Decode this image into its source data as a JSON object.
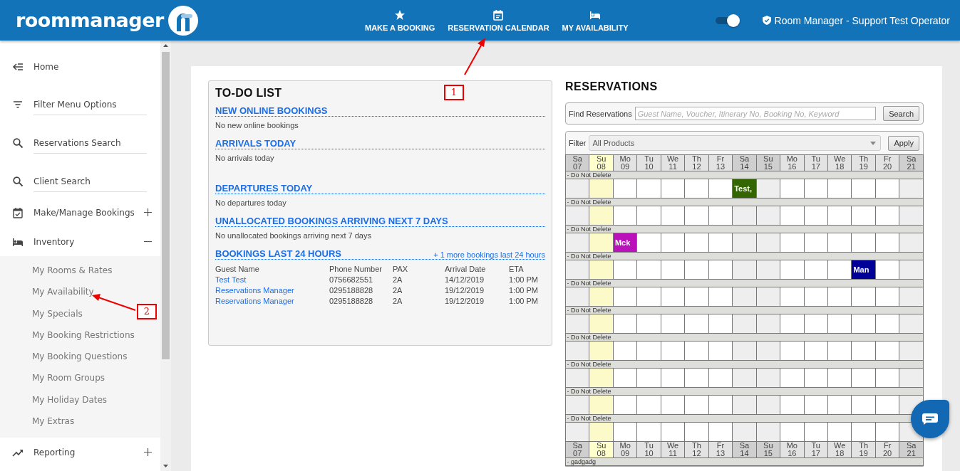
{
  "header": {
    "logo": "roommanager",
    "nav": [
      {
        "label": "MAKE A BOOKING"
      },
      {
        "label": "RESERVATION CALENDAR"
      },
      {
        "label": "MY AVAILABILITY"
      }
    ],
    "toggle": {
      "on": true
    },
    "user": "Room Manager - Support Test Operator"
  },
  "sidebar": {
    "items": [
      {
        "label": "Home",
        "kind": "link"
      },
      {
        "label": "Filter Menu Options",
        "kind": "field"
      },
      {
        "label": "Reservations Search",
        "kind": "field"
      },
      {
        "label": "Client Search",
        "kind": "field"
      },
      {
        "label": "Make/Manage Bookings",
        "kind": "group",
        "expanded": false
      },
      {
        "label": "Inventory",
        "kind": "group",
        "expanded": true,
        "children": [
          {
            "label": "My Rooms & Rates"
          },
          {
            "label": "My Availability"
          },
          {
            "label": "My Specials"
          },
          {
            "label": "My Booking Restrictions"
          },
          {
            "label": "My Booking Questions"
          },
          {
            "label": "My Room Groups"
          },
          {
            "label": "My Holiday Dates"
          },
          {
            "label": "My Extras"
          }
        ]
      },
      {
        "label": "Reporting",
        "kind": "group",
        "expanded": false
      }
    ]
  },
  "todo": {
    "title": "TO-DO LIST",
    "sections": [
      {
        "heading": "NEW ONLINE BOOKINGS",
        "message": "No new online bookings"
      },
      {
        "heading": "ARRIVALS TODAY",
        "message": "No arrivals today"
      },
      {
        "heading": "DEPARTURES TODAY",
        "message": "No departures today"
      },
      {
        "heading": "UNALLOCATED BOOKINGS ARRIVING NEXT 7 DAYS",
        "message": "No unallocated bookings arriving next 7 days"
      },
      {
        "heading": "BOOKINGS LAST 24 HOURS",
        "more_link": "+ 1 more bookings last 24 hours",
        "columns": [
          "Guest Name",
          "Phone Number",
          "PAX",
          "Arrival Date",
          "ETA"
        ],
        "rows": [
          [
            "Test Test",
            "0756682551",
            "2A",
            "14/12/2019",
            "1:00 PM"
          ],
          [
            "Reservations Manager",
            "0295188828",
            "2A",
            "19/12/2019",
            "1:00 PM"
          ],
          [
            "Reservations Manager",
            "0295188828",
            "2A",
            "19/12/2019",
            "1:00 PM"
          ]
        ]
      }
    ]
  },
  "reservations": {
    "title": "RESERVATIONS",
    "find_label": "Find Reservations",
    "find_placeholder": "Guest Name, Voucher, Itinerary No, Booking No, Keyword",
    "search_button": "Search",
    "filter_label": "Filter",
    "filter_value": "All Products",
    "apply_button": "Apply",
    "calendar": {
      "days": [
        {
          "dow": "Sa",
          "date": "07",
          "kind": "weekend"
        },
        {
          "dow": "Su",
          "date": "08",
          "kind": "today"
        },
        {
          "dow": "Mo",
          "date": "09",
          "kind": "weekday"
        },
        {
          "dow": "Tu",
          "date": "10",
          "kind": "weekday"
        },
        {
          "dow": "We",
          "date": "11",
          "kind": "weekday"
        },
        {
          "dow": "Th",
          "date": "12",
          "kind": "weekday"
        },
        {
          "dow": "Fr",
          "date": "13",
          "kind": "weekday"
        },
        {
          "dow": "Sa",
          "date": "14",
          "kind": "weekend"
        },
        {
          "dow": "Su",
          "date": "15",
          "kind": "weekend"
        },
        {
          "dow": "Mo",
          "date": "16",
          "kind": "weekday"
        },
        {
          "dow": "Tu",
          "date": "17",
          "kind": "weekday"
        },
        {
          "dow": "We",
          "date": "18",
          "kind": "weekday"
        },
        {
          "dow": "Th",
          "date": "19",
          "kind": "weekday"
        },
        {
          "dow": "Fr",
          "date": "20",
          "kind": "weekday"
        },
        {
          "dow": "Sa",
          "date": "21",
          "kind": "weekend"
        }
      ],
      "groups": [
        {
          "label": "Do Not Delete",
          "cells": [
            {
              "kind": "free"
            },
            {
              "kind": "free"
            },
            {
              "kind": "free"
            },
            {
              "kind": "free"
            },
            {
              "kind": "free"
            },
            {
              "kind": "free"
            },
            {
              "kind": "free"
            },
            {
              "kind": "booking",
              "label": "Test,",
              "color": "#336600"
            },
            {
              "kind": "free"
            },
            {
              "kind": "free"
            },
            {
              "kind": "free"
            },
            {
              "kind": "free"
            },
            {
              "kind": "free"
            },
            {
              "kind": "free"
            },
            {
              "kind": "free"
            }
          ]
        },
        {
          "label": "Do Not Delete"
        },
        {
          "label": "Do Not Delete",
          "cells": [
            {
              "kind": "free"
            },
            {
              "kind": "free"
            },
            {
              "kind": "booking",
              "label": "Mck",
              "color": "#bb11bb"
            },
            {
              "kind": "free"
            },
            {
              "kind": "free"
            },
            {
              "kind": "free"
            },
            {
              "kind": "free"
            },
            {
              "kind": "free"
            },
            {
              "kind": "free"
            },
            {
              "kind": "free"
            },
            {
              "kind": "free"
            },
            {
              "kind": "free"
            },
            {
              "kind": "free"
            },
            {
              "kind": "free"
            },
            {
              "kind": "free"
            }
          ]
        },
        {
          "label": "Do Not Delete",
          "cells": [
            {
              "kind": "free"
            },
            {
              "kind": "free"
            },
            {
              "kind": "free"
            },
            {
              "kind": "free"
            },
            {
              "kind": "free"
            },
            {
              "kind": "free"
            },
            {
              "kind": "free"
            },
            {
              "kind": "free"
            },
            {
              "kind": "free"
            },
            {
              "kind": "free"
            },
            {
              "kind": "free"
            },
            {
              "kind": "free"
            },
            {
              "kind": "booking",
              "label": "Man",
              "color": "#000099"
            },
            {
              "kind": "free"
            },
            {
              "kind": "free"
            }
          ]
        },
        {
          "label": "Do Not Delete"
        },
        {
          "label": "Do Not Delete"
        },
        {
          "label": "Do Not Delete"
        },
        {
          "label": "Do Not Delete"
        },
        {
          "label": "Do Not Delete"
        },
        {
          "label": "Do Not Delete"
        }
      ],
      "footer_days": [
        {
          "dow": "Sa",
          "date": "07",
          "kind": "weekend"
        },
        {
          "dow": "Su",
          "date": "08",
          "kind": "today"
        },
        {
          "dow": "Mo",
          "date": "09",
          "kind": "weekday"
        },
        {
          "dow": "Tu",
          "date": "10",
          "kind": "weekday"
        },
        {
          "dow": "We",
          "date": "11",
          "kind": "weekday"
        },
        {
          "dow": "Th",
          "date": "12",
          "kind": "weekday"
        },
        {
          "dow": "Fr",
          "date": "13",
          "kind": "weekday"
        },
        {
          "dow": "Sa",
          "date": "14",
          "kind": "weekend"
        },
        {
          "dow": "Su",
          "date": "15",
          "kind": "weekend"
        },
        {
          "dow": "Mo",
          "date": "16",
          "kind": "weekday"
        },
        {
          "dow": "Tu",
          "date": "17",
          "kind": "weekday"
        },
        {
          "dow": "We",
          "date": "18",
          "kind": "weekday"
        },
        {
          "dow": "Th",
          "date": "19",
          "kind": "weekday"
        },
        {
          "dow": "Fr",
          "date": "20",
          "kind": "weekday"
        },
        {
          "dow": "Sa",
          "date": "21",
          "kind": "weekend"
        }
      ],
      "next_group": "gadgadg"
    }
  },
  "annotations": [
    {
      "label": "1"
    },
    {
      "label": "2"
    }
  ]
}
